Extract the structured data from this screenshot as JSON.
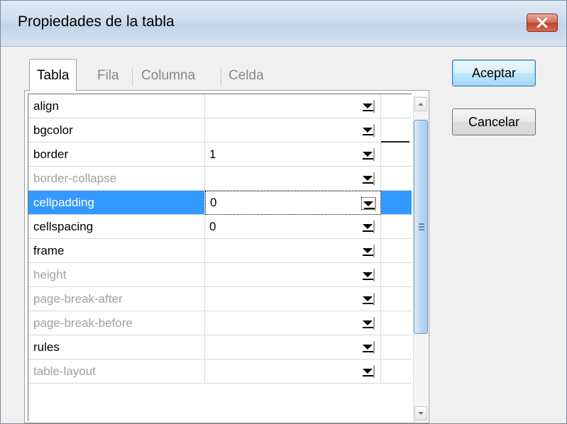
{
  "window": {
    "title": "Propiedades de la tabla"
  },
  "tabs": [
    {
      "label": "Tabla",
      "active": true
    },
    {
      "label": "Fila",
      "active": false
    },
    {
      "label": "Columna",
      "active": false
    },
    {
      "label": "Celda",
      "active": false
    }
  ],
  "properties": [
    {
      "name": "align",
      "value": "",
      "enabled": true
    },
    {
      "name": "bgcolor",
      "value": "",
      "enabled": true
    },
    {
      "name": "border",
      "value": "1",
      "enabled": true
    },
    {
      "name": "border-collapse",
      "value": "",
      "enabled": false
    },
    {
      "name": "cellpadding",
      "value": "0",
      "enabled": true,
      "selected": true
    },
    {
      "name": "cellspacing",
      "value": "0",
      "enabled": true
    },
    {
      "name": "frame",
      "value": "",
      "enabled": true
    },
    {
      "name": "height",
      "value": "",
      "enabled": false
    },
    {
      "name": "page-break-after",
      "value": "",
      "enabled": false
    },
    {
      "name": "page-break-before",
      "value": "",
      "enabled": false
    },
    {
      "name": "rules",
      "value": "",
      "enabled": true
    },
    {
      "name": "table-layout",
      "value": "",
      "enabled": false
    }
  ],
  "buttons": {
    "ok": "Aceptar",
    "cancel": "Cancelar"
  },
  "colors": {
    "selection": "#3399ff",
    "close_button": "#c1432a",
    "disabled_text": "#a0a0a0"
  },
  "icons": {
    "close": "close-x-icon",
    "dropdown": "chevron-down-icon",
    "scroll_up": "scroll-up-arrow-icon",
    "scroll_down": "scroll-down-arrow-icon"
  }
}
